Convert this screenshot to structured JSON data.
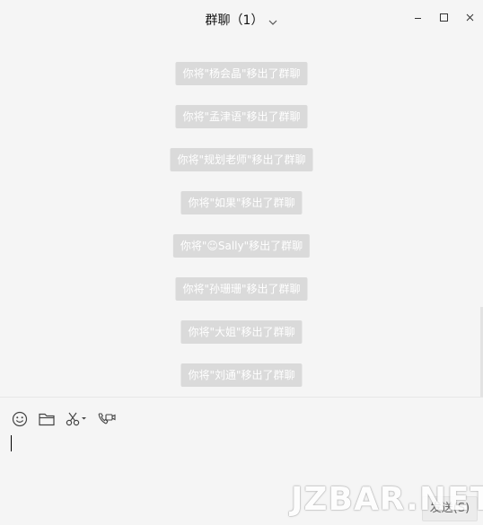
{
  "window": {
    "title": "群聊（1）",
    "controls": [
      "minimize-icon",
      "maximize-icon",
      "close-icon"
    ]
  },
  "messages": [
    {
      "text": "你将\"杨会晶\"移出了群聊"
    },
    {
      "text": "你将\"孟津语\"移出了群聊"
    },
    {
      "text": "你将\"规划老师\"移出了群聊"
    },
    {
      "text": "你将\"如果\"移出了群聊"
    },
    {
      "text": "你将\"☺Sally\"移出了群聊"
    },
    {
      "text": "你将\"孙珊珊\"移出了群聊"
    },
    {
      "text": "你将\"大姐\"移出了群聊"
    },
    {
      "text": "你将\"刘通\"移出了群聊"
    }
  ],
  "toolbar": {
    "icons": [
      "emoji-icon",
      "folder-icon",
      "scissors-icon",
      "video-call-icon"
    ]
  },
  "composer": {
    "send_label": "发送(S)"
  },
  "watermark": "JZBAR.NET",
  "colors": {
    "background": "#f5f5f5",
    "system_message_bg": "#dadada",
    "system_message_text": "#ffffff"
  }
}
